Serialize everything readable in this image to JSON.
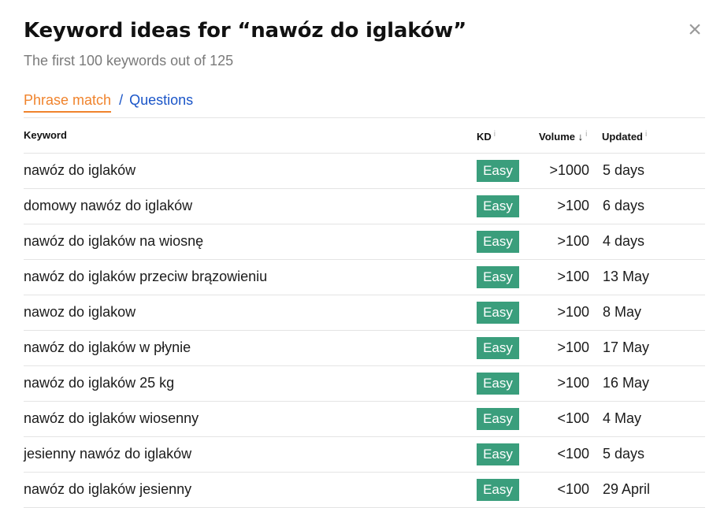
{
  "dialog": {
    "title": "Keyword ideas for “nawóz do iglaków”",
    "subtitle": "The first 100 keywords out of 125",
    "close_icon": "×"
  },
  "tabs": {
    "phrase_match": "Phrase match",
    "separator": "/",
    "questions": "Questions",
    "active": "phrase_match",
    "active_color": "#f0832c",
    "link_color": "#1a55c8"
  },
  "table": {
    "columns": {
      "keyword": "Keyword",
      "kd": "KD",
      "volume": "Volume ↓",
      "updated": "Updated",
      "info_icon": "i"
    },
    "kd_badge_color": "#3a9e7c",
    "rows": [
      {
        "keyword": "nawóz do iglaków",
        "kd": "Easy",
        "volume": ">1000",
        "updated": "5 days"
      },
      {
        "keyword": "domowy nawóz do iglaków",
        "kd": "Easy",
        "volume": ">100",
        "updated": "6 days"
      },
      {
        "keyword": "nawóz do iglaków na wiosnę",
        "kd": "Easy",
        "volume": ">100",
        "updated": "4 days"
      },
      {
        "keyword": "nawóz do iglaków przeciw brązowieniu",
        "kd": "Easy",
        "volume": ">100",
        "updated": "13 May"
      },
      {
        "keyword": "nawoz do iglakow",
        "kd": "Easy",
        "volume": ">100",
        "updated": "8 May"
      },
      {
        "keyword": "nawóz do iglaków w płynie",
        "kd": "Easy",
        "volume": ">100",
        "updated": "17 May"
      },
      {
        "keyword": "nawóz do iglaków 25 kg",
        "kd": "Easy",
        "volume": ">100",
        "updated": "16 May"
      },
      {
        "keyword": "nawóz do iglaków wiosenny",
        "kd": "Easy",
        "volume": "<100",
        "updated": "4 May"
      },
      {
        "keyword": "jesienny nawóz do iglaków",
        "kd": "Easy",
        "volume": "<100",
        "updated": "5 days"
      },
      {
        "keyword": "nawóz do iglaków jesienny",
        "kd": "Easy",
        "volume": "<100",
        "updated": "29 April"
      }
    ]
  }
}
